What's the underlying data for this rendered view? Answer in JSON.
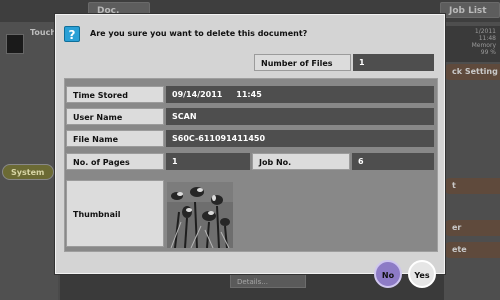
{
  "background": {
    "tabs": [
      "Doc. Preview",
      "Job List"
    ],
    "touch_label": "Touch",
    "system_label": "System",
    "right_info_lines": [
      "1/2011",
      "11:48",
      "Memory",
      "99 %"
    ],
    "right_buttons": [
      "ck Setting",
      "t",
      "er",
      "ete"
    ],
    "details_label": "Details..."
  },
  "dialog": {
    "question": "Are you sure you want to delete this document?",
    "number_of_files_label": "Number of Files",
    "number_of_files_value": "1",
    "time_stored_label": "Time Stored",
    "time_stored_value": "09/14/2011     11:45",
    "user_name_label": "User Name",
    "user_name_value": "SCAN",
    "file_name_label": "File Name",
    "file_name_value": "S60C-611091411450",
    "pages_label": "No. of Pages",
    "pages_value": "1",
    "job_no_label": "Job No.",
    "job_no_value": "6",
    "thumbnail_label": "Thumbnail",
    "no_label": "No",
    "yes_label": "Yes"
  },
  "colors": {
    "accent_no": "#8d7bc6",
    "question_icon": "#2aa0d6"
  }
}
